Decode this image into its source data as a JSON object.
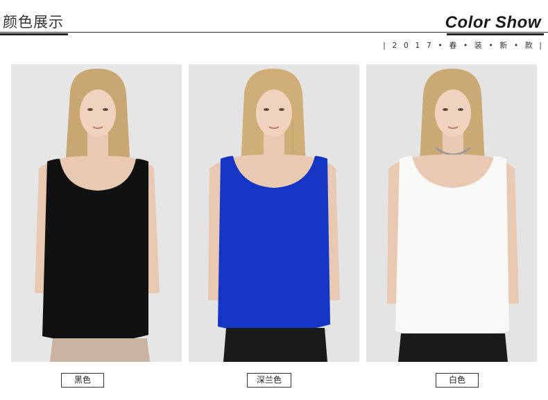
{
  "header": {
    "title_cn": "颜色展示",
    "title_en": "Color Show",
    "subtitle": "| 2 0 1 7 • 春 • 装 • 新 • 款 |"
  },
  "colors": [
    {
      "label": "黑色",
      "swatch": "#111111"
    },
    {
      "label": "深兰色",
      "swatch": "#1535c4"
    },
    {
      "label": "白色",
      "swatch": "#f8f8f6"
    }
  ]
}
